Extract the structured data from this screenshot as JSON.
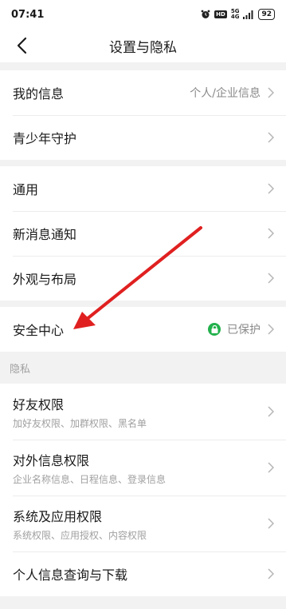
{
  "status_bar": {
    "time": "07:41",
    "hd": "HD",
    "network_top": "5G",
    "network_bottom": "4G",
    "battery": "92"
  },
  "nav": {
    "title": "设置与隐私",
    "back_icon": "back-arrow-icon"
  },
  "group1": [
    {
      "label": "我的信息",
      "value": "个人/企业信息"
    },
    {
      "label": "青少年守护"
    }
  ],
  "group2": [
    {
      "label": "通用"
    },
    {
      "label": "新消息通知"
    },
    {
      "label": "外观与布局"
    }
  ],
  "group3": [
    {
      "label": "安全中心",
      "value": "已保护"
    }
  ],
  "privacy_section": {
    "header": "隐私",
    "items": [
      {
        "label": "好友权限",
        "sub": "加好友权限、加群权限、黑名单"
      },
      {
        "label": "对外信息权限",
        "sub": "企业名称信息、日程信息、登录信息"
      },
      {
        "label": "系统及应用权限",
        "sub": "系统权限、应用授权、内容权限"
      },
      {
        "label": "个人信息查询与下载"
      }
    ]
  },
  "colors": {
    "accent_green": "#22b14c",
    "annotation_arrow": "#e02020"
  }
}
